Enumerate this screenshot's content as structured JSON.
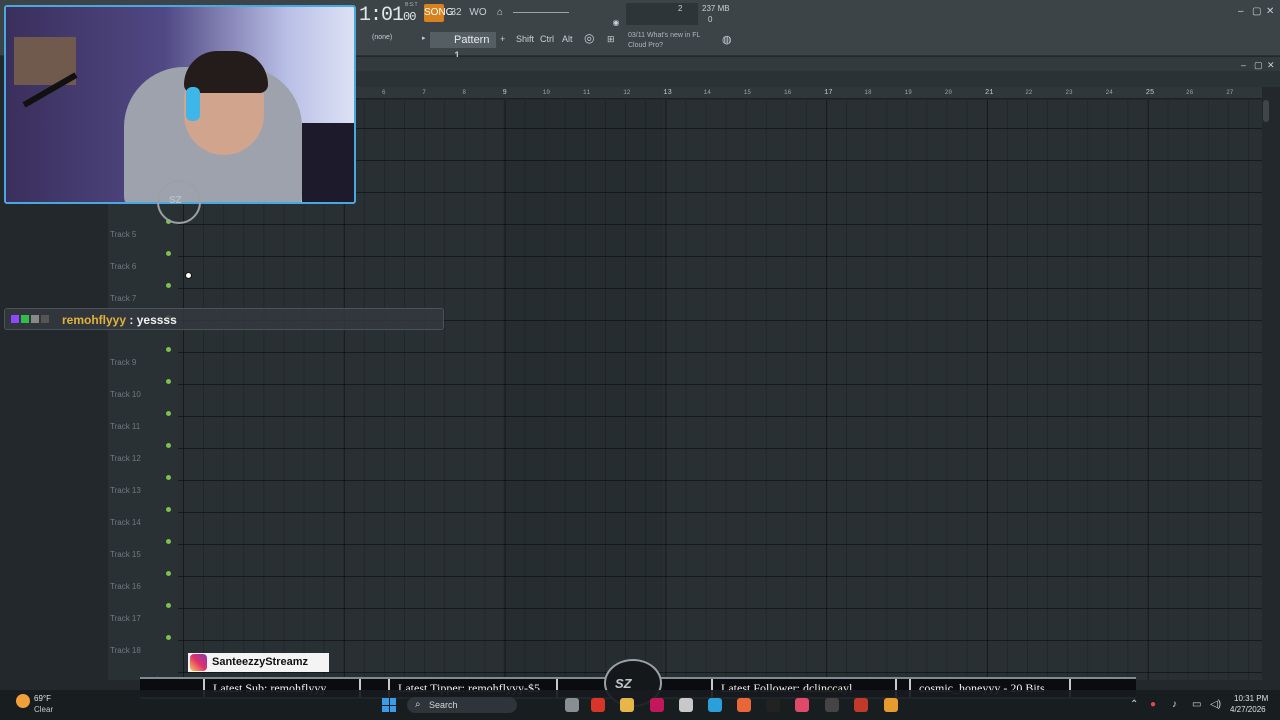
{
  "fl": {
    "time": "1:01",
    "time_sub": "00",
    "bst_label": "B:S:T",
    "memory": "237 MB",
    "cpu_num": "2",
    "poly": "0",
    "snap": "(none)",
    "pattern": "Pattern 1",
    "shift": "Shift",
    "ctrl": "Ctrl",
    "alt": "Alt",
    "news_date": "03/11",
    "news_line1": "What's new in FL",
    "news_line2": "Cloud Pro?",
    "btn_song": "SONG",
    "btn_step": "32",
    "btn_wait": "WO",
    "colors": {
      "accent": "#d8821e",
      "track_dot": "#7dc24a",
      "grid": "#293033"
    }
  },
  "playlist": {
    "ruler": [
      "6",
      "7",
      "8",
      "9",
      "10",
      "11",
      "12",
      "13",
      "14",
      "15",
      "16",
      "17",
      "18",
      "19",
      "20",
      "21",
      "22",
      "23",
      "24",
      "25",
      "26",
      "27"
    ],
    "tracks": [
      "Track 5",
      "Track 6",
      "Track 7",
      "Track 9",
      "Track 10",
      "Track 11",
      "Track 12",
      "Track 13",
      "Track 14",
      "Track 15",
      "Track 16",
      "Track 17",
      "Track 18"
    ]
  },
  "chat": {
    "user": "remohflyyy",
    "separator": ":",
    "message": "yessss"
  },
  "overlay": {
    "instagram": "SanteezzyStreamz",
    "latest_sub": "Latest Sub: remohflyyy",
    "latest_tipper": "Latest Tipper: remohflyyy-$5",
    "latest_follower": "Latest Follower: dclinccayl",
    "bits": "cosmic_honeyyy - 20 Bits",
    "logo_text": "SZ"
  },
  "taskbar": {
    "temp": "69°F",
    "condition": "Clear",
    "search": "Search",
    "time": "10:31 PM",
    "date": "4/27/2026"
  }
}
